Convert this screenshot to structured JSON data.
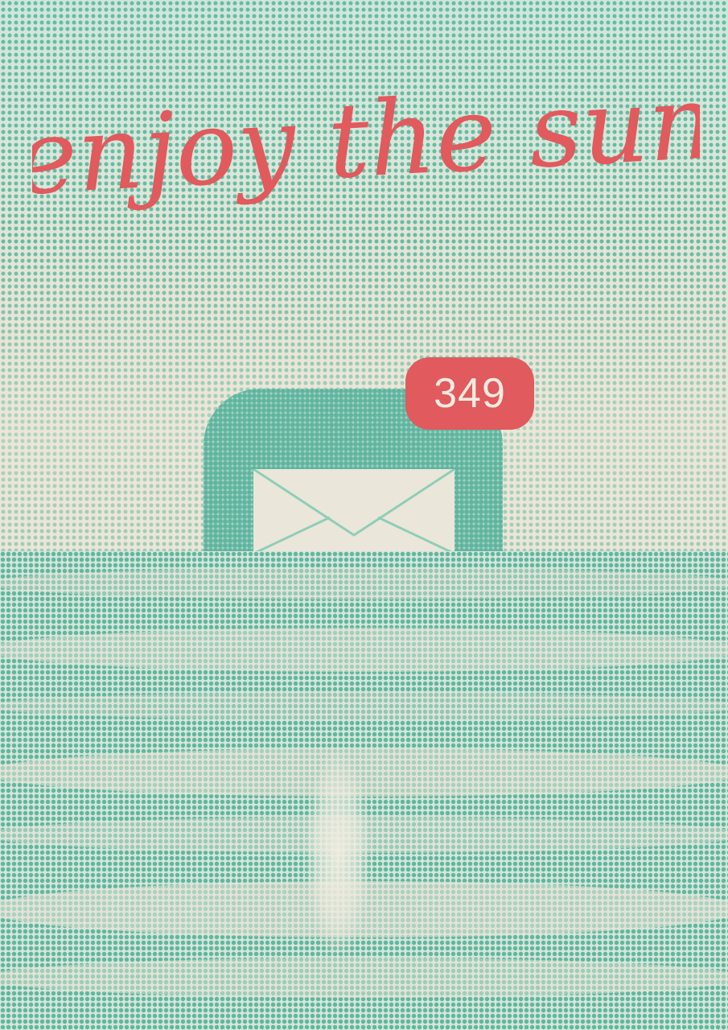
{
  "poster": {
    "headline": "enjoy the sun",
    "notification_badge": "349",
    "icon": "mail-icon"
  },
  "colors": {
    "headline": "#e05a5e",
    "badge": "#e05a5e",
    "halftone_teal": "#5fb9a0",
    "paper": "#ebe6da"
  }
}
